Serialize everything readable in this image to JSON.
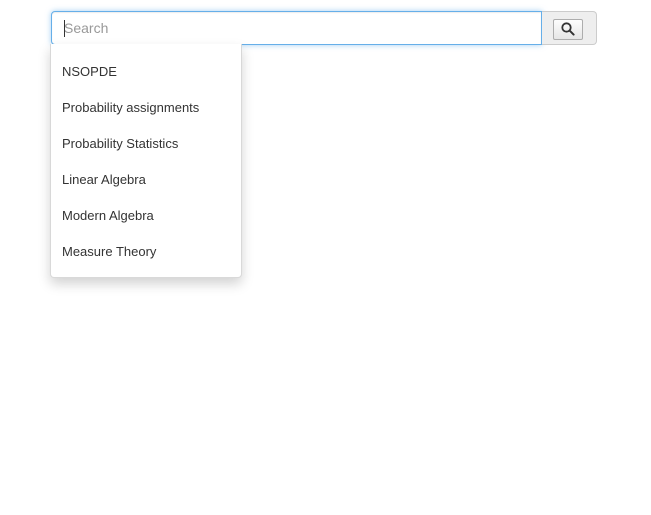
{
  "search": {
    "placeholder": "Search",
    "value": "",
    "button_icon": "search-icon"
  },
  "suggestions": [
    {
      "label": "NSOPDE"
    },
    {
      "label": "Probability assignments"
    },
    {
      "label": "Probability Statistics"
    },
    {
      "label": "Linear Algebra"
    },
    {
      "label": "Modern Algebra"
    },
    {
      "label": "Measure Theory"
    }
  ],
  "colors": {
    "focus_border": "#66afe9",
    "text": "#333333",
    "addon_background": "#eeeeee"
  }
}
